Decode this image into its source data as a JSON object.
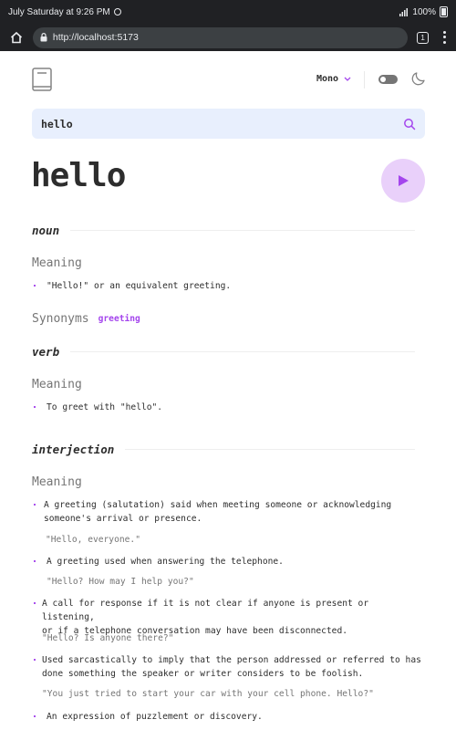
{
  "status_bar": {
    "time": "July Saturday at 9:26 PM",
    "battery": "100%"
  },
  "browser": {
    "url": "http://localhost:5173",
    "tab_count": "1"
  },
  "header": {
    "font_label": "Mono"
  },
  "search": {
    "value": "hello"
  },
  "entry": {
    "word": "hello",
    "noun": {
      "pos": "noun",
      "meaning_label": "Meaning",
      "definitions": [
        "\"Hello!\" or an equivalent greeting."
      ],
      "synonyms_label": "Synonyms",
      "synonyms": [
        "greeting"
      ]
    },
    "verb": {
      "pos": "verb",
      "meaning_label": "Meaning",
      "definitions": [
        "To greet with \"hello\"."
      ]
    },
    "interjection": {
      "pos": "interjection",
      "meaning_label": "Meaning",
      "definitions": [
        {
          "line1": "A greeting (salutation) said when meeting someone or acknowledging",
          "line2": "someone's arrival or presence.",
          "example": "\"Hello, everyone.\""
        },
        {
          "line1": "A greeting used when answering the telephone.",
          "line2": "",
          "example": "\"Hello? How may I help you?\""
        },
        {
          "line1": "A call for response if it is not clear if anyone is present or listening,",
          "line2": "or if a telephone conversation may have been disconnected.",
          "example": "\"Hello? Is anyone there?\""
        },
        {
          "line1": "Used sarcastically to imply that the person addressed or referred to has",
          "line2": "done something the speaker or writer considers to be foolish.",
          "example": "\"You just tried to start your car with your cell phone. Hello?\""
        },
        {
          "line1": "An expression of puzzlement or discovery.",
          "line2": "",
          "example": ""
        }
      ]
    }
  },
  "colors": {
    "accent": "#A445ED",
    "play_bg": "#E9D0FA",
    "search_bg": "#E8EFFD",
    "text": "#2D2D2D",
    "muted": "#757575"
  }
}
